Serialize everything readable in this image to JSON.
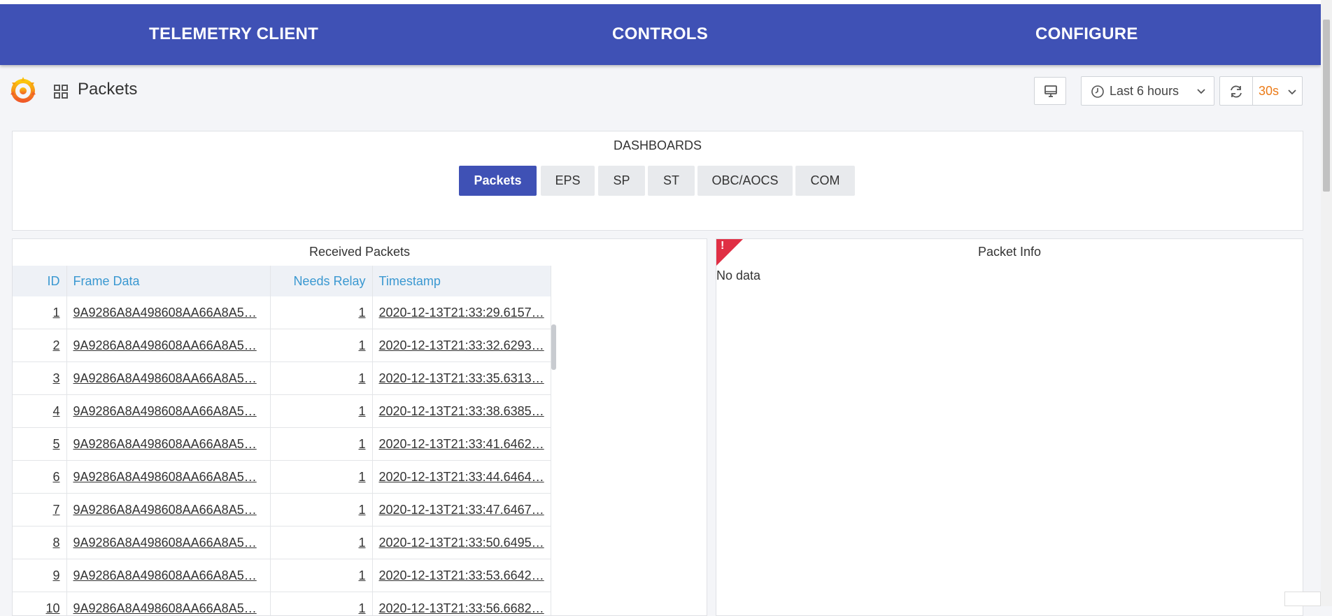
{
  "nav": {
    "items": [
      {
        "label": "TELEMETRY CLIENT"
      },
      {
        "label": "CONTROLS"
      },
      {
        "label": "CONFIGURE"
      }
    ]
  },
  "toolbar": {
    "title": "Packets",
    "time_range": "Last 6 hours",
    "refresh_interval": "30s"
  },
  "dashboards": {
    "title": "DASHBOARDS",
    "buttons": [
      {
        "label": "Packets",
        "active": true
      },
      {
        "label": "EPS"
      },
      {
        "label": "SP"
      },
      {
        "label": "ST"
      },
      {
        "label": "OBC/AOCS"
      },
      {
        "label": "COM"
      }
    ]
  },
  "received_packets": {
    "title": "Received Packets",
    "columns": [
      "ID",
      "Frame Data",
      "Needs Relay",
      "Timestamp"
    ],
    "rows": [
      {
        "id": "1",
        "frame": "9A9286A8A498608AA66A8A5…",
        "relay": "1",
        "ts": "2020-12-13T21:33:29.6157…"
      },
      {
        "id": "2",
        "frame": "9A9286A8A498608AA66A8A5…",
        "relay": "1",
        "ts": "2020-12-13T21:33:32.6293…"
      },
      {
        "id": "3",
        "frame": "9A9286A8A498608AA66A8A5…",
        "relay": "1",
        "ts": "2020-12-13T21:33:35.6313…"
      },
      {
        "id": "4",
        "frame": "9A9286A8A498608AA66A8A5…",
        "relay": "1",
        "ts": "2020-12-13T21:33:38.6385…"
      },
      {
        "id": "5",
        "frame": "9A9286A8A498608AA66A8A5…",
        "relay": "1",
        "ts": "2020-12-13T21:33:41.6462…"
      },
      {
        "id": "6",
        "frame": "9A9286A8A498608AA66A8A5…",
        "relay": "1",
        "ts": "2020-12-13T21:33:44.6464…"
      },
      {
        "id": "7",
        "frame": "9A9286A8A498608AA66A8A5…",
        "relay": "1",
        "ts": "2020-12-13T21:33:47.6467…"
      },
      {
        "id": "8",
        "frame": "9A9286A8A498608AA66A8A5…",
        "relay": "1",
        "ts": "2020-12-13T21:33:50.6495…"
      },
      {
        "id": "9",
        "frame": "9A9286A8A498608AA66A8A5…",
        "relay": "1",
        "ts": "2020-12-13T21:33:53.6642…"
      },
      {
        "id": "10",
        "frame": "9A9286A8A498608AA66A8A5…",
        "relay": "1",
        "ts": "2020-12-13T21:33:56.6682…"
      }
    ]
  },
  "packet_info": {
    "title": "Packet Info",
    "error_mark": "!",
    "empty_text": "No data"
  },
  "colors": {
    "navbar": "#3f51b5",
    "header_text": "#3a98d1",
    "refresh_interval": "#eb7b18",
    "error": "#e02f44"
  }
}
